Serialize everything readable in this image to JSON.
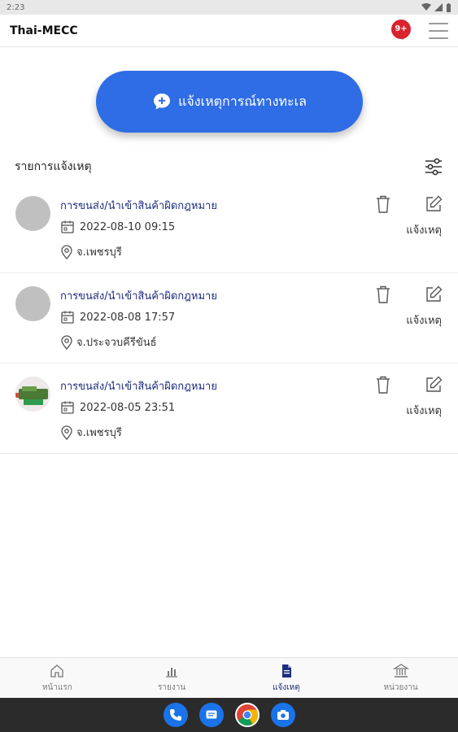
{
  "status_bar": {
    "time": "2:23"
  },
  "app_bar": {
    "title": "Thai-MECC",
    "notification_badge": "9+"
  },
  "report_button": {
    "label": "แจ้งเหตุการณ์ทางทะเล",
    "icon": "chat-plus-icon"
  },
  "list_header": {
    "label": "รายการแจ้งเหตุ",
    "filter_icon": "sliders-icon"
  },
  "items": [
    {
      "title": "การขนส่ง/นำเข้าสินค้าผิดกฎหมาย",
      "datetime": "2022-08-10 09:15",
      "location": "จ.เพชรบุรี",
      "status": "แจ้งเหตุ",
      "avatar": "placeholder"
    },
    {
      "title": "การขนส่ง/นำเข้าสินค้าผิดกฎหมาย",
      "datetime": "2022-08-08 17:57",
      "location": "จ.ประจวบคีรีขันธ์",
      "status": "แจ้งเหตุ",
      "avatar": "placeholder"
    },
    {
      "title": "การขนส่ง/นำเข้าสินค้าผิดกฎหมาย",
      "datetime": "2022-08-05 23:51",
      "location": "จ.เพชรบุรี",
      "status": "แจ้งเหตุ",
      "avatar": "photo"
    }
  ],
  "bottom_nav": [
    {
      "label": "หน้าแรก",
      "icon": "home-icon",
      "active": false
    },
    {
      "label": "รายงาน",
      "icon": "bar-chart-icon",
      "active": false
    },
    {
      "label": "แจ้งเหตุ",
      "icon": "document-icon",
      "active": true
    },
    {
      "label": "หน่วยงาน",
      "icon": "bank-icon",
      "active": false
    }
  ],
  "colors": {
    "primary": "#2f6de6",
    "title_text": "#1e2d7d",
    "badge": "#d9232d"
  }
}
